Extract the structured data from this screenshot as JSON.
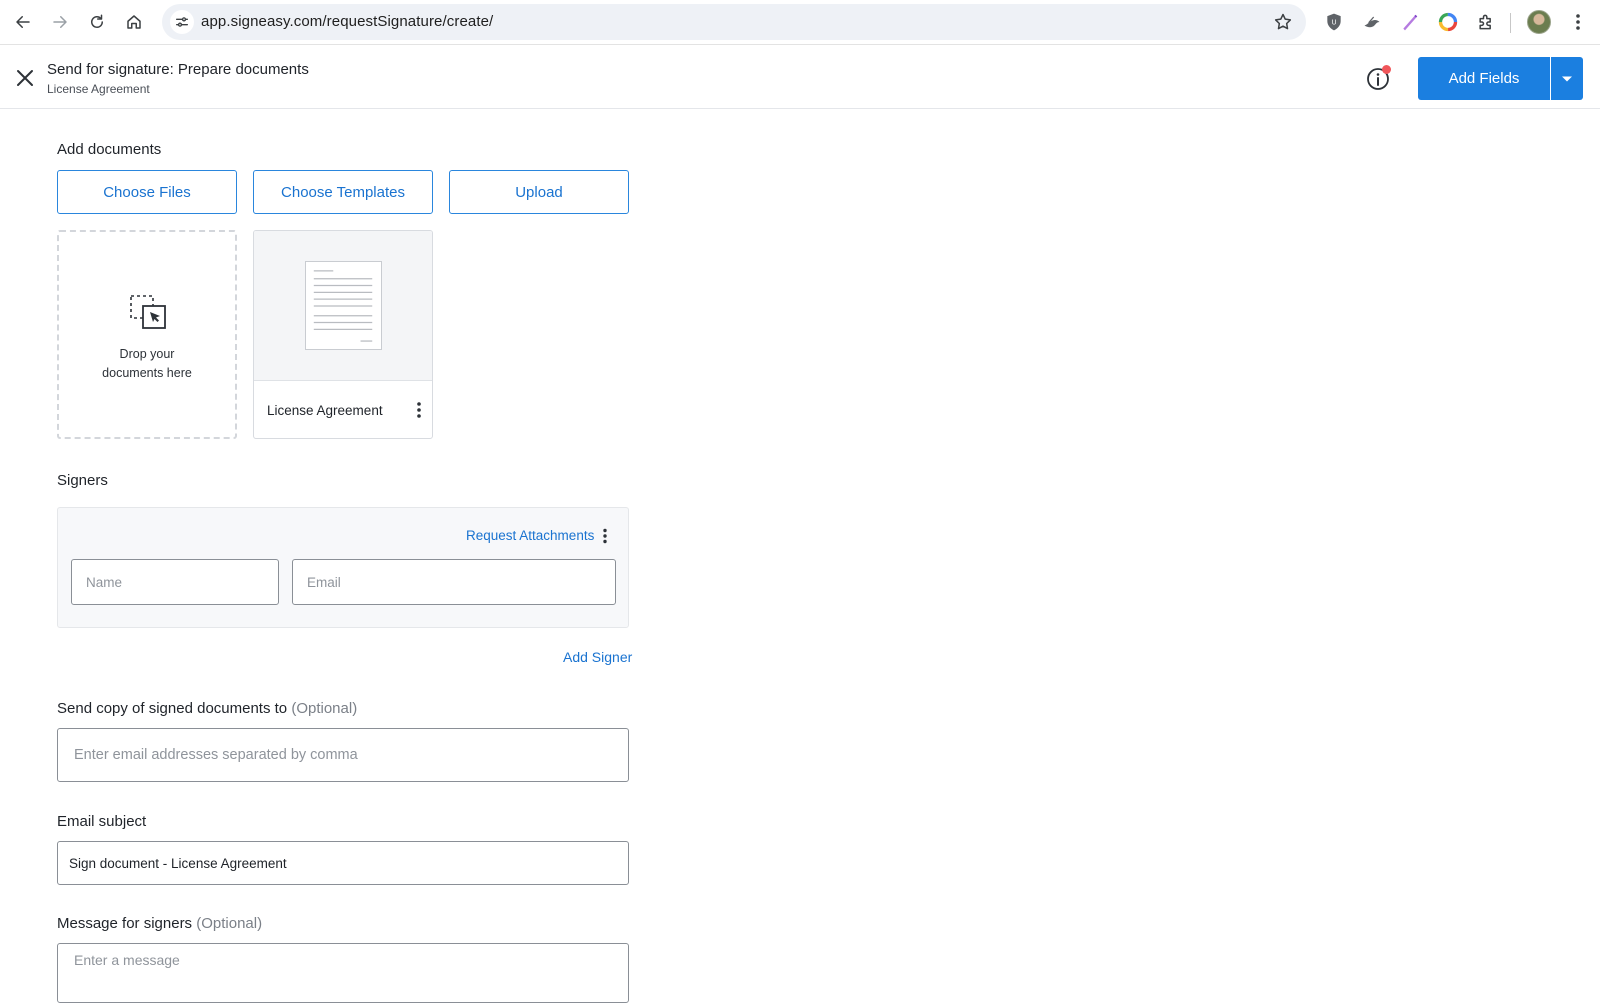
{
  "browser": {
    "url": "app.signeasy.com/requestSignature/create/",
    "extensions": [
      "shield-extension-icon",
      "bird-extension-icon",
      "pen-extension-icon",
      "color-wheel-extension-icon",
      "puzzle-extensions-icon"
    ]
  },
  "header": {
    "title": "Send for signature: Prepare documents",
    "subtitle": "License Agreement",
    "primary_button": "Add Fields",
    "notification_dot_color": "#f0565a"
  },
  "documents": {
    "label": "Add documents",
    "buttons": {
      "choose_files": "Choose Files",
      "choose_templates": "Choose Templates",
      "upload": "Upload"
    },
    "drop_zone_text": "Drop your documents here",
    "items": [
      {
        "name": "License Agreement"
      }
    ]
  },
  "signers": {
    "label": "Signers",
    "request_attachments": "Request Attachments",
    "name_placeholder": "Name",
    "email_placeholder": "Email",
    "add_signer": "Add Signer"
  },
  "copy_to": {
    "label": "Send copy of signed documents to",
    "optional": "(Optional)",
    "placeholder": "Enter email addresses separated by comma"
  },
  "email_subject": {
    "label": "Email subject",
    "value": "Sign document - License Agreement"
  },
  "message": {
    "label": "Message for signers",
    "optional": "(Optional)",
    "placeholder": "Enter a message"
  },
  "colors": {
    "accent": "#1b7fe0",
    "link": "#1a73d0"
  }
}
